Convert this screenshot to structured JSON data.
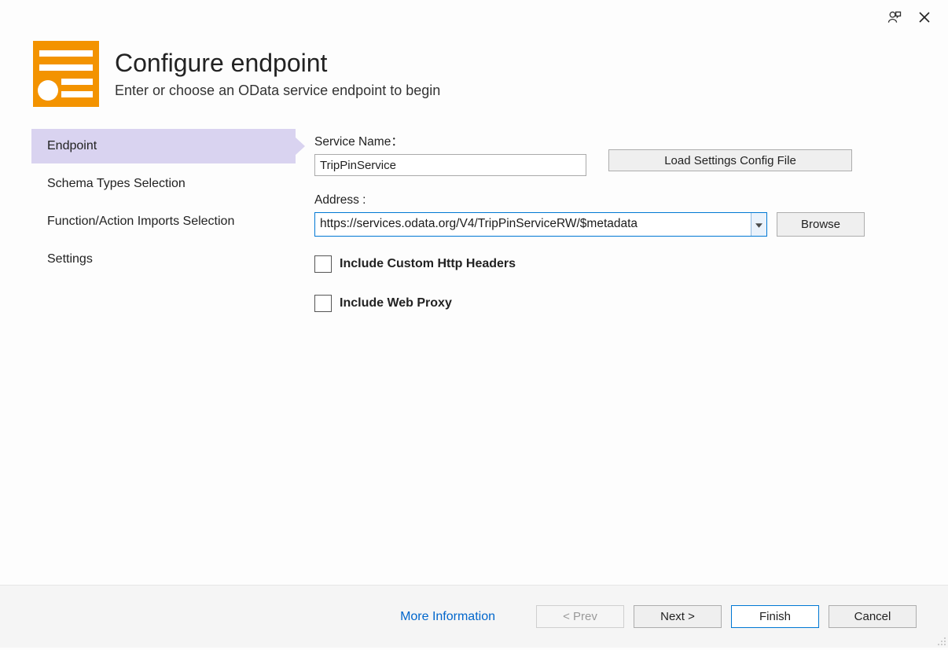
{
  "header": {
    "title": "Configure endpoint",
    "subtitle": "Enter or choose an OData service endpoint to begin"
  },
  "sidebar": {
    "items": [
      {
        "label": "Endpoint"
      },
      {
        "label": "Schema Types Selection"
      },
      {
        "label": "Function/Action Imports Selection"
      },
      {
        "label": "Settings"
      }
    ]
  },
  "form": {
    "service_name_label": "Service Name：",
    "service_name_value": "TripPinService",
    "load_config_button": "Load Settings Config File",
    "address_label": "Address :",
    "address_value": "https://services.odata.org/V4/TripPinServiceRW/$metadata",
    "browse_button": "Browse",
    "include_headers_label": "Include Custom Http Headers",
    "include_proxy_label": "Include Web Proxy"
  },
  "footer": {
    "more_info": "More Information",
    "prev": "< Prev",
    "next": "Next >",
    "finish": "Finish",
    "cancel": "Cancel"
  }
}
